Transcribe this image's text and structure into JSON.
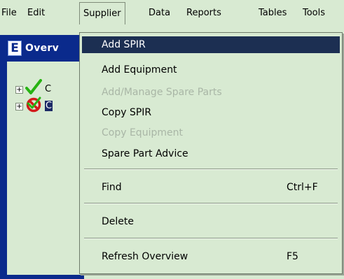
{
  "menubar": {
    "items": [
      "File",
      "Edit",
      "Supplier",
      "Data",
      "Reports",
      "Tables",
      "Tools"
    ],
    "active_index": 2
  },
  "window": {
    "title": "Overv",
    "title_icon_letter": "E"
  },
  "tree": {
    "rows": [
      {
        "text": "C",
        "icon": "checkmark-icon",
        "selected": false
      },
      {
        "text": "C",
        "icon": "prohibited-icon",
        "selected": true
      }
    ]
  },
  "dropdown": {
    "groups": [
      [
        {
          "label": "Add SPIR",
          "shortcut": "",
          "enabled": true,
          "highlighted": true
        },
        {
          "label": "Add Equipment",
          "shortcut": "",
          "enabled": true,
          "highlighted": false
        },
        {
          "label": "Add/Manage Spare Parts",
          "shortcut": "",
          "enabled": false,
          "highlighted": false
        },
        {
          "label": "Copy SPIR",
          "shortcut": "",
          "enabled": true,
          "highlighted": false
        },
        {
          "label": "Copy Equipment",
          "shortcut": "",
          "enabled": false,
          "highlighted": false
        },
        {
          "label": "Spare Part Advice",
          "shortcut": "",
          "enabled": true,
          "highlighted": false
        }
      ],
      [
        {
          "label": "Find",
          "shortcut": "Ctrl+F",
          "enabled": true,
          "highlighted": false
        }
      ],
      [
        {
          "label": "Delete",
          "shortcut": "",
          "enabled": true,
          "highlighted": false
        }
      ],
      [
        {
          "label": "Refresh Overview",
          "shortcut": "F5",
          "enabled": true,
          "highlighted": false
        }
      ]
    ]
  },
  "colors": {
    "background": "#d8ead2",
    "highlight": "#1c2f52",
    "window_frame": "#0a2a8c",
    "disabled_text": "#a9b6a6"
  }
}
